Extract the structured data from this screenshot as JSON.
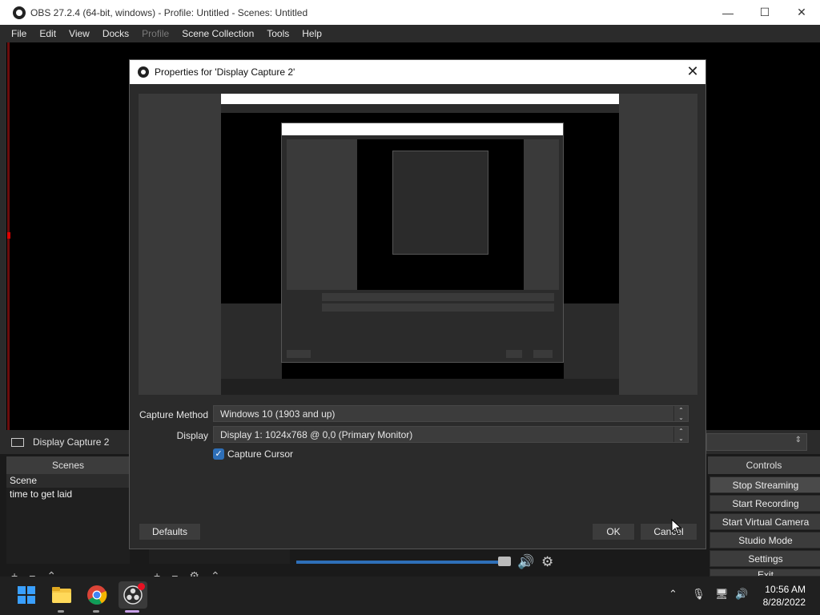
{
  "app": {
    "title": "OBS 27.2.4 (64-bit, windows) - Profile: Untitled - Scenes: Untitled",
    "window_buttons": [
      "—",
      "☐",
      "✕"
    ]
  },
  "menu": {
    "items": [
      "File",
      "Edit",
      "View",
      "Docks",
      "Profile",
      "Scene Collection",
      "Tools",
      "Help"
    ],
    "disabled": [
      "Profile"
    ]
  },
  "source_bar": {
    "label": "Display Capture 2"
  },
  "scenes": {
    "title": "Scenes",
    "items": [
      "Scene",
      "time to get laid"
    ]
  },
  "controls": {
    "title": "Controls",
    "buttons": [
      "Stop Streaming",
      "Start Recording",
      "Start Virtual Camera",
      "Studio Mode",
      "Settings",
      "Exit"
    ]
  },
  "dialog": {
    "title": "Properties for 'Display Capture 2'",
    "capture_method_label": "Capture Method",
    "capture_method_value": "Windows 10 (1903 and up)",
    "display_label": "Display",
    "display_value": "Display 1: 1024x768 @ 0,0 (Primary Monitor)",
    "capture_cursor_label": "Capture Cursor",
    "capture_cursor_checked": true,
    "defaults_button": "Defaults",
    "ok_button": "OK",
    "cancel_button": "Cancel"
  },
  "taskbar": {
    "time": "10:56 AM",
    "date": "8/28/2022",
    "tray_icons": [
      "chevron-up-icon",
      "microphone-icon",
      "network-icon",
      "volume-icon"
    ]
  },
  "colors": {
    "accent_blue": "#2e6fb8",
    "panel": "#2b2b2b",
    "button": "#3c3c3c"
  }
}
